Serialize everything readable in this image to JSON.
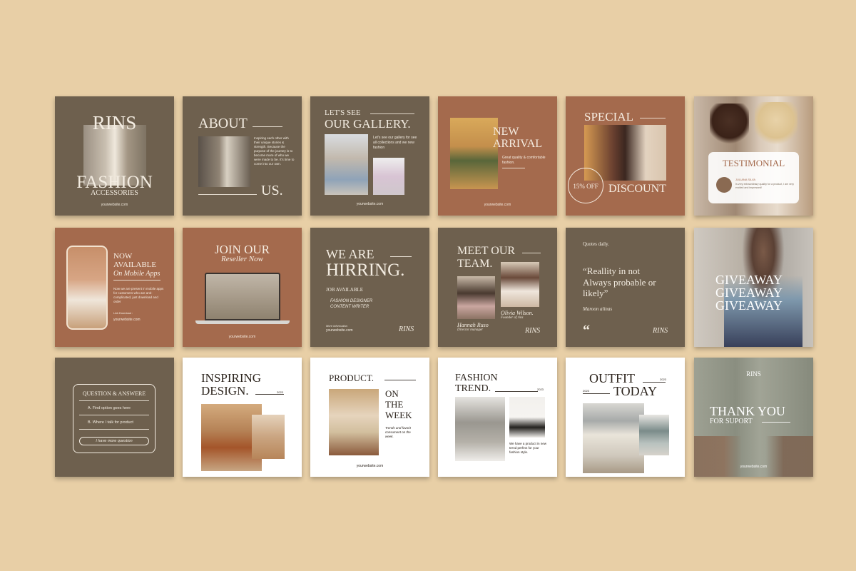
{
  "colors": {
    "background": "#e8cfa6",
    "olive": "#6e604e",
    "rust": "#a46a4d",
    "white": "#ffffff"
  },
  "website": "yourwebsite.com",
  "brand": "RINS",
  "tiles": {
    "t1": {
      "line1": "RINS",
      "line2": "FASHION",
      "line3": "ACCESSORIES"
    },
    "t2": {
      "line1": "ABOUT",
      "line2": "US.",
      "body": "Inspiring each other with their unique stories & strength. Because the purpose of the journey is to become more of who we were made to be. It's time to come into our own."
    },
    "t3": {
      "line1": "LET'S SEE",
      "line2": "OUR GALLERY.",
      "body": "Let's see our gallery for see all collections and we new fashion"
    },
    "t4": {
      "line1": "NEW",
      "line2": "ARRIVAL",
      "body": "Great quality & comfortable fashion."
    },
    "t5": {
      "line1": "SPECIAL",
      "line2": "DISCOUNT",
      "badge": "15% OFF"
    },
    "t6": {
      "title": "TESTIMONIAL",
      "name": "JULIANA SILVA",
      "quote": "Is very extraordinary quality for a product, I am very excited and impressed!"
    },
    "t7": {
      "line1": "NOW",
      "line2": "AVAILABLE",
      "line3": "On Mobile Apps",
      "body": "Now we are present in mobile apps for customers who are anti-complicated, just download and order",
      "link": "Link Download :"
    },
    "t8": {
      "line1": "JOIN OUR",
      "line2": "Reseller Now"
    },
    "t9": {
      "line1": "WE ARE",
      "line2": "HIRRING.",
      "sub": "JOB AVAILABLE",
      "job1": "FASHION DESIGNER",
      "job2": "CONTENT WRITER",
      "more": "More information"
    },
    "t10": {
      "line1": "MEET OUR",
      "line2": "TEAM.",
      "p1_name": "Hannah Ruso",
      "p1_role": "Director manager",
      "p2_name": "Olivia Wilson.",
      "p2_role": "Founder of rins"
    },
    "t11": {
      "header": "Quotes daily.",
      "quote": "“Reallity in not Always probable or likely”",
      "author": "Maroon alinas",
      "mark": "“"
    },
    "t12": {
      "word": "GIVEAWAY"
    },
    "t13": {
      "title": "QUESTION & ANSWERE",
      "a": "A. Find option goes here",
      "b": "B. Where I talk for product",
      "button": "I have more question"
    },
    "t14": {
      "line1": "INSPIRING",
      "line2": "DESIGN.",
      "year": "2023"
    },
    "t15": {
      "line1": "PRODUCT.",
      "line2": "ON",
      "line3": "THE",
      "line4": "WEEK",
      "body": "Trends and favorit consument on the week."
    },
    "t16": {
      "line1": "FASHION",
      "line2": "TREND.",
      "year": "2023",
      "body": "We have a product in new trend perfect for your fashion style."
    },
    "t17": {
      "line1": "OUTFIT",
      "line2": "TODAY",
      "year1": "2023",
      "year2": "2023"
    },
    "t18": {
      "line1": "THANK YOU",
      "line2": "FOR SUPORT"
    }
  }
}
